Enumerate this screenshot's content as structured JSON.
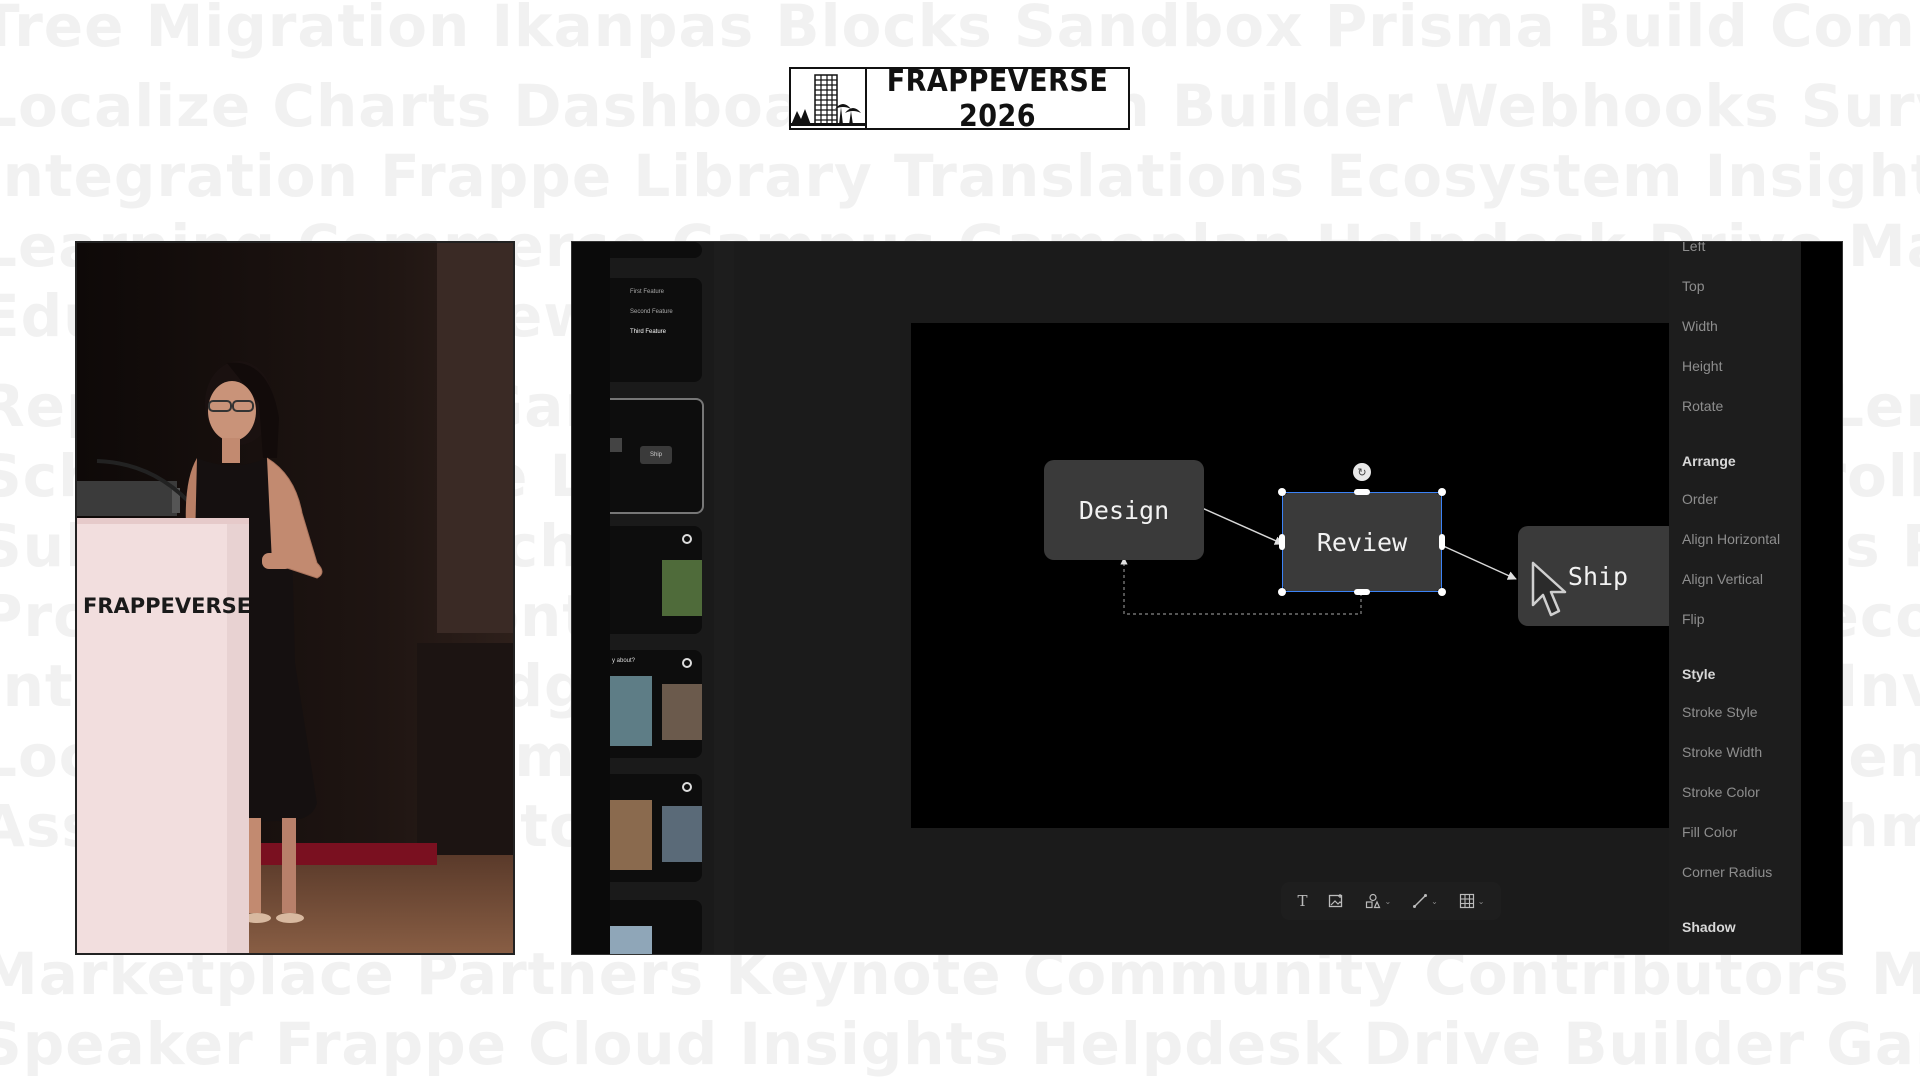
{
  "event": {
    "logo_text": "FRAPPEVERSE 2026",
    "podium_text": "FRAPPEVERSE"
  },
  "slides_panel": {
    "slide_items": [
      "First Feature",
      "Second Feature",
      "Third Feature"
    ],
    "thumb_node_label": "Ship",
    "thumb_question": "y about?"
  },
  "diagram": {
    "nodes": [
      {
        "id": "design",
        "label": "Design"
      },
      {
        "id": "review",
        "label": "Review",
        "selected": true
      },
      {
        "id": "ship",
        "label": "Ship"
      }
    ]
  },
  "toolbar": {
    "items": [
      {
        "name": "text-tool",
        "icon": "T"
      },
      {
        "name": "image-tool",
        "icon": "image-icon",
        "caret": false
      },
      {
        "name": "shape-tool",
        "icon": "shapes-icon",
        "caret": true
      },
      {
        "name": "line-tool",
        "icon": "line-icon",
        "caret": true
      },
      {
        "name": "table-tool",
        "icon": "table-icon",
        "caret": true
      }
    ]
  },
  "properties_panel": {
    "position_items": [
      "Left",
      "Top",
      "Width",
      "Height",
      "Rotate"
    ],
    "arrange_title": "Arrange",
    "arrange_items": [
      "Order",
      "Align Horizontal",
      "Align Vertical",
      "Flip"
    ],
    "style_title": "Style",
    "style_items": [
      "Stroke Style",
      "Stroke Width",
      "Stroke Color",
      "Fill Color",
      "Corner Radius"
    ],
    "shadow_title": "Shadow"
  },
  "colors": {
    "selection": "#3b82f6",
    "node_fill": "#3a3a3a",
    "canvas_frame": "#000000",
    "podium": "#f2dede"
  }
}
